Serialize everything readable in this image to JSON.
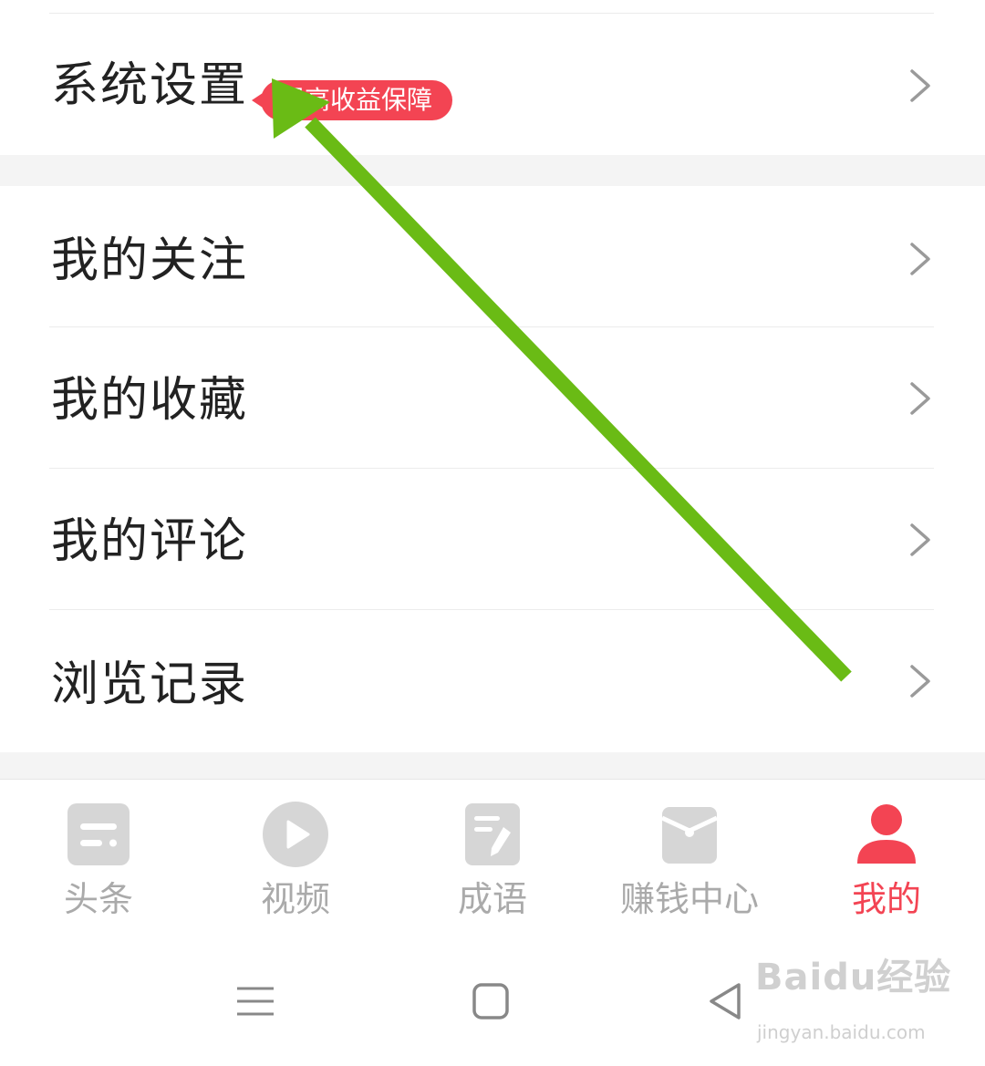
{
  "menu": {
    "group1": [
      {
        "label": "系统设置",
        "badge": "提高收益保障"
      }
    ],
    "group2": [
      {
        "label": "我的关注"
      },
      {
        "label": "我的收藏"
      },
      {
        "label": "我的评论"
      },
      {
        "label": "浏览记录"
      }
    ]
  },
  "tabbar": {
    "tabs": [
      {
        "label": "头条",
        "icon": "news-icon",
        "active": false
      },
      {
        "label": "视频",
        "icon": "play-icon",
        "active": false
      },
      {
        "label": "成语",
        "icon": "note-edit-icon",
        "active": false
      },
      {
        "label": "赚钱中心",
        "icon": "wallet-icon",
        "active": false
      },
      {
        "label": "我的",
        "icon": "person-icon",
        "active": true
      }
    ]
  },
  "system_nav": {
    "buttons": [
      "menu-icon",
      "home-icon",
      "back-icon"
    ]
  },
  "watermark": {
    "main": "Baidu经验",
    "sub": "jingyan.baidu.com"
  },
  "colors": {
    "accent": "#f34453",
    "inactive": "#aaaaaa",
    "arrow": "#6abb15"
  }
}
